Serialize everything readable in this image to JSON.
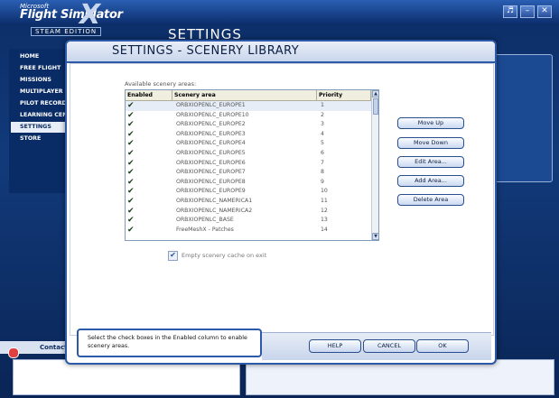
{
  "app": {
    "logo_top": "Microsoft",
    "logo_main": "Flight Simulator",
    "logo_x": "X",
    "logo_edition": "STEAM EDITION",
    "background_title": "SETTINGS",
    "contacts_label": "Contacts"
  },
  "sidebar": {
    "items": [
      {
        "label": "HOME"
      },
      {
        "label": "FREE FLIGHT"
      },
      {
        "label": "MISSIONS"
      },
      {
        "label": "MULTIPLAYER"
      },
      {
        "label": "PILOT RECORDS"
      },
      {
        "label": "LEARNING CENTER"
      },
      {
        "label": "SETTINGS"
      },
      {
        "label": "STORE"
      }
    ],
    "active_index": 6
  },
  "dialog": {
    "title": "SETTINGS - SCENERY LIBRARY",
    "areas_label": "Available scenery areas:",
    "columns": [
      "Enabled",
      "Scenery area",
      "Priority"
    ],
    "rows": [
      {
        "enabled": true,
        "name": "ORBXIOPENLC_EUROPE1",
        "priority": "1"
      },
      {
        "enabled": true,
        "name": "ORBXIOPENLC_EUROPE10",
        "priority": "2"
      },
      {
        "enabled": true,
        "name": "ORBXIOPENLC_EUROPE2",
        "priority": "3"
      },
      {
        "enabled": true,
        "name": "ORBXIOPENLC_EUROPE3",
        "priority": "4"
      },
      {
        "enabled": true,
        "name": "ORBXIOPENLC_EUROPE4",
        "priority": "5"
      },
      {
        "enabled": true,
        "name": "ORBXIOPENLC_EUROPE5",
        "priority": "6"
      },
      {
        "enabled": true,
        "name": "ORBXIOPENLC_EUROPE6",
        "priority": "7"
      },
      {
        "enabled": true,
        "name": "ORBXIOPENLC_EUROPE7",
        "priority": "8"
      },
      {
        "enabled": true,
        "name": "ORBXIOPENLC_EUROPE8",
        "priority": "9"
      },
      {
        "enabled": true,
        "name": "ORBXIOPENLC_EUROPE9",
        "priority": "10"
      },
      {
        "enabled": true,
        "name": "ORBXIOPENLC_NAMERICA1",
        "priority": "11"
      },
      {
        "enabled": true,
        "name": "ORBXIOPENLC_NAMERICA2",
        "priority": "12"
      },
      {
        "enabled": true,
        "name": "ORBXIOPENLC_BASE",
        "priority": "13"
      },
      {
        "enabled": true,
        "name": "FreeMeshX - Patches",
        "priority": "14"
      }
    ],
    "selected_index": 0,
    "actions": {
      "move_up": "Move Up",
      "move_down": "Move Down",
      "edit_area": "Edit Area...",
      "add_area": "Add Area...",
      "delete_area": "Delete Area"
    },
    "cache_label": "Empty scenery cache on exit",
    "cache_checked": true,
    "help_text": "Select the check boxes in the Enabled column to enable scenery areas.",
    "footer": {
      "help": "HELP",
      "cancel": "CANCEL",
      "ok": "OK"
    }
  },
  "icons": {
    "check": "checkmark-icon",
    "arrow_up": "scroll-up-arrow-icon",
    "arrow_down": "scroll-down-arrow-icon"
  },
  "colors": {
    "accent": "#2c5aa8",
    "background": "#0c2d66"
  }
}
